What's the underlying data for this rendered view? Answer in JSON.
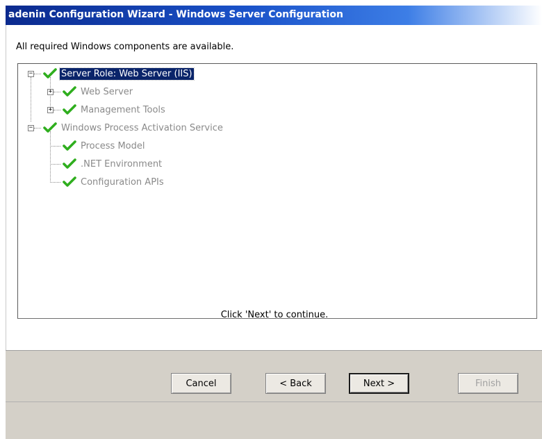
{
  "window": {
    "title": "adenin Configuration Wizard - Windows Server Configuration"
  },
  "content": {
    "status_message": "All required Windows components are available.",
    "continue_message": "Click 'Next' to continue."
  },
  "tree": {
    "items": [
      {
        "label": "Server Role: Web Server (IIS)",
        "level": 0,
        "expanded": true,
        "selected": true,
        "icon": "green-check-icon"
      },
      {
        "label": "Web Server",
        "level": 1,
        "expanded": false,
        "selected": false,
        "icon": "green-check-icon"
      },
      {
        "label": "Management Tools",
        "level": 1,
        "expanded": false,
        "selected": false,
        "icon": "green-check-icon"
      },
      {
        "label": "Windows Process Activation Service",
        "level": 0,
        "expanded": true,
        "selected": false,
        "icon": "green-check-icon"
      },
      {
        "label": "Process Model",
        "level": 1,
        "selected": false,
        "icon": "green-check-icon"
      },
      {
        "label": ".NET Environment",
        "level": 1,
        "selected": false,
        "icon": "green-check-icon"
      },
      {
        "label": "Configuration APIs",
        "level": 1,
        "selected": false,
        "icon": "green-check-icon"
      }
    ]
  },
  "buttons": {
    "cancel": "Cancel",
    "back": "< Back",
    "next": "Next >",
    "finish": "Finish"
  },
  "colors": {
    "title_gradient_start": "#0b2a8e",
    "selection": "#0a246a",
    "check_green": "#2fae1e",
    "panel": "#d4d0c8"
  }
}
